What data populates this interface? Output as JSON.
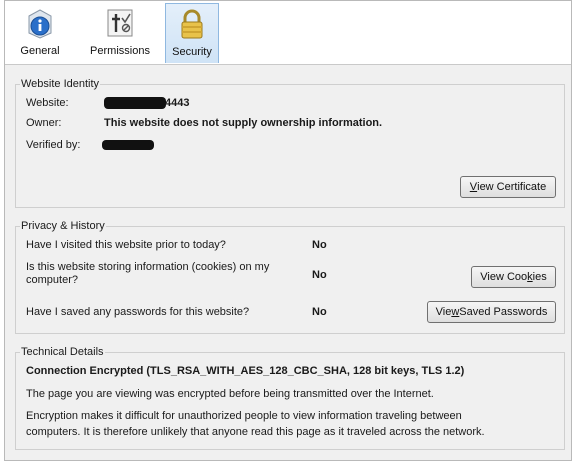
{
  "tabs": [
    {
      "label": "General",
      "icon": "info-icon"
    },
    {
      "label": "Permissions",
      "icon": "permissions-icon"
    },
    {
      "label": "Security",
      "icon": "padlock-icon",
      "selected": true
    }
  ],
  "identity": {
    "title": "Website Identity",
    "website_label": "Website:",
    "website_value_suffix": "4443",
    "owner_label": "Owner:",
    "owner_value": "This website does not supply ownership information.",
    "verified_label": "Verified by:",
    "view_certificate_pre": "",
    "view_certificate_accel": "V",
    "view_certificate_post": "iew Certificate"
  },
  "privacy": {
    "title": "Privacy & History",
    "q1": "Have I visited this website prior to today?",
    "a1": "No",
    "q2": "Is this website storing information (cookies) on my computer?",
    "a2": "No",
    "q3": "Have I saved any passwords for this website?",
    "a3": "No",
    "cookies_pre": "View Coo",
    "cookies_accel": "k",
    "cookies_post": "ies",
    "passwords_pre": "Vie",
    "passwords_accel": "w",
    "passwords_post": " Saved Passwords"
  },
  "technical": {
    "title": "Technical Details",
    "connection": "Connection Encrypted (TLS_RSA_WITH_AES_128_CBC_SHA, 128 bit keys, TLS 1.2)",
    "line1": "The page you are viewing was encrypted before being transmitted over the Internet.",
    "line2": "Encryption makes it difficult for unauthorized people to view information traveling between",
    "line3": "computers. It is therefore unlikely that anyone read this page as it traveled across the network."
  },
  "colors": {
    "selected_tab": "#cfe3f6",
    "panel_bg": "#f0f0f0"
  }
}
